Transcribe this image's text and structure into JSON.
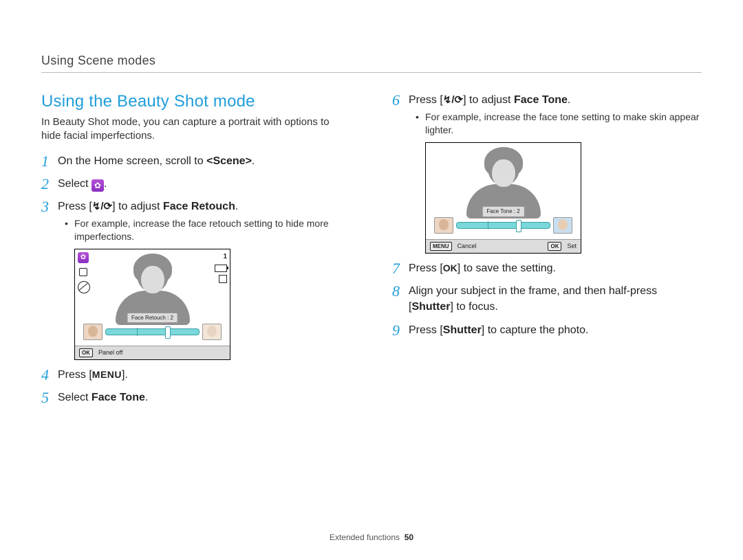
{
  "breadcrumb": "Using Scene modes",
  "section_title": "Using the Beauty Shot mode",
  "intro": "In Beauty Shot mode, you can capture a portrait with options to hide facial imperfections.",
  "up_down_glyph": "↯/⟳",
  "menu_glyph": "MENU",
  "ok_glyph": "OK",
  "steps": {
    "s1": {
      "pre": "On the Home screen, scroll to ",
      "bold": "<Scene>",
      "post": "."
    },
    "s2": {
      "pre": "Select ",
      "post": "."
    },
    "s3": {
      "pre": "Press [",
      "mid": "] to adjust ",
      "bold": "Face Retouch",
      "post": "."
    },
    "s3_sub": "For example, increase the face retouch setting to hide more imperfections.",
    "s4": {
      "pre": "Press [",
      "post": "]."
    },
    "s5": {
      "pre": "Select ",
      "bold": "Face Tone",
      "post": "."
    },
    "s6": {
      "pre": "Press [",
      "mid": "] to adjust ",
      "bold": "Face Tone",
      "post": "."
    },
    "s6_sub": "For example, increase the face tone setting to make skin appear lighter.",
    "s7": {
      "pre": "Press [",
      "post": "] to save the setting."
    },
    "s8": {
      "pre": "Align your subject in the frame, and then half-press [",
      "bold": "Shutter",
      "post": "] to focus."
    },
    "s9": {
      "pre": "Press [",
      "bold": "Shutter",
      "post": "] to capture the photo."
    }
  },
  "screenshot_left": {
    "one": "1",
    "label": "Face Retouch : 2",
    "footer_pill": "OK",
    "footer_text": "Panel off"
  },
  "screenshot_right": {
    "label": "Face Tone : 2",
    "footer_pill1": "MENU",
    "footer_text1": "Cancel",
    "footer_pill2": "OK",
    "footer_text2": "Set"
  },
  "footer": {
    "label": "Extended functions",
    "page": "50"
  }
}
